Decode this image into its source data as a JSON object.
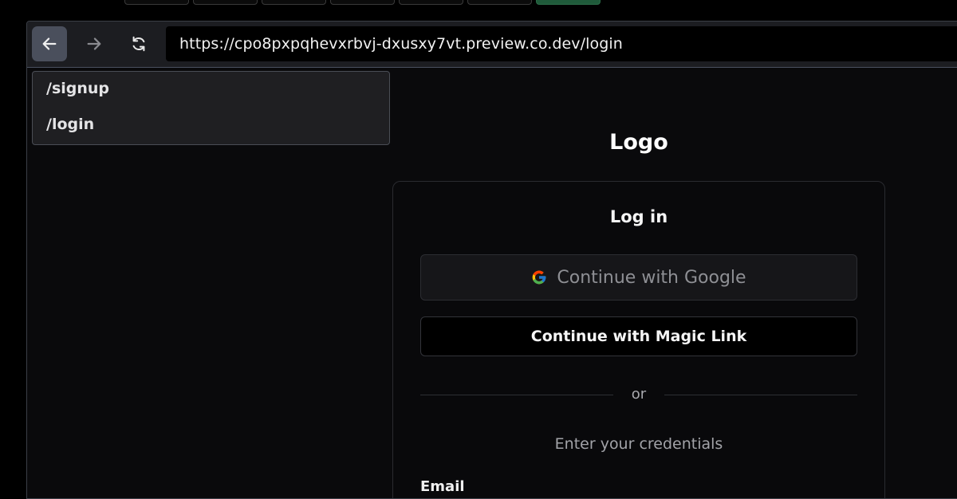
{
  "browser": {
    "url": "https://cpo8pxpqhevxrbvj-dxusxy7vt.preview.co.dev/login",
    "nav": {
      "back_icon": "arrow-left-icon",
      "forward_icon": "arrow-right-icon",
      "reload_icon": "reload-icon"
    },
    "suggestions": [
      "/signup",
      "/login"
    ]
  },
  "page": {
    "logo": "Logo",
    "card": {
      "title": "Log in",
      "google_button": "Continue with Google",
      "google_icon": "google-icon",
      "magic_link_button": "Continue with Magic Link",
      "divider": "or",
      "subtitle": "Enter your credentials",
      "email_label": "Email"
    }
  },
  "colors": {
    "active_tab": "#1f5a3a",
    "background": "#0a0a0c",
    "back_button": "#4a4f5c"
  }
}
